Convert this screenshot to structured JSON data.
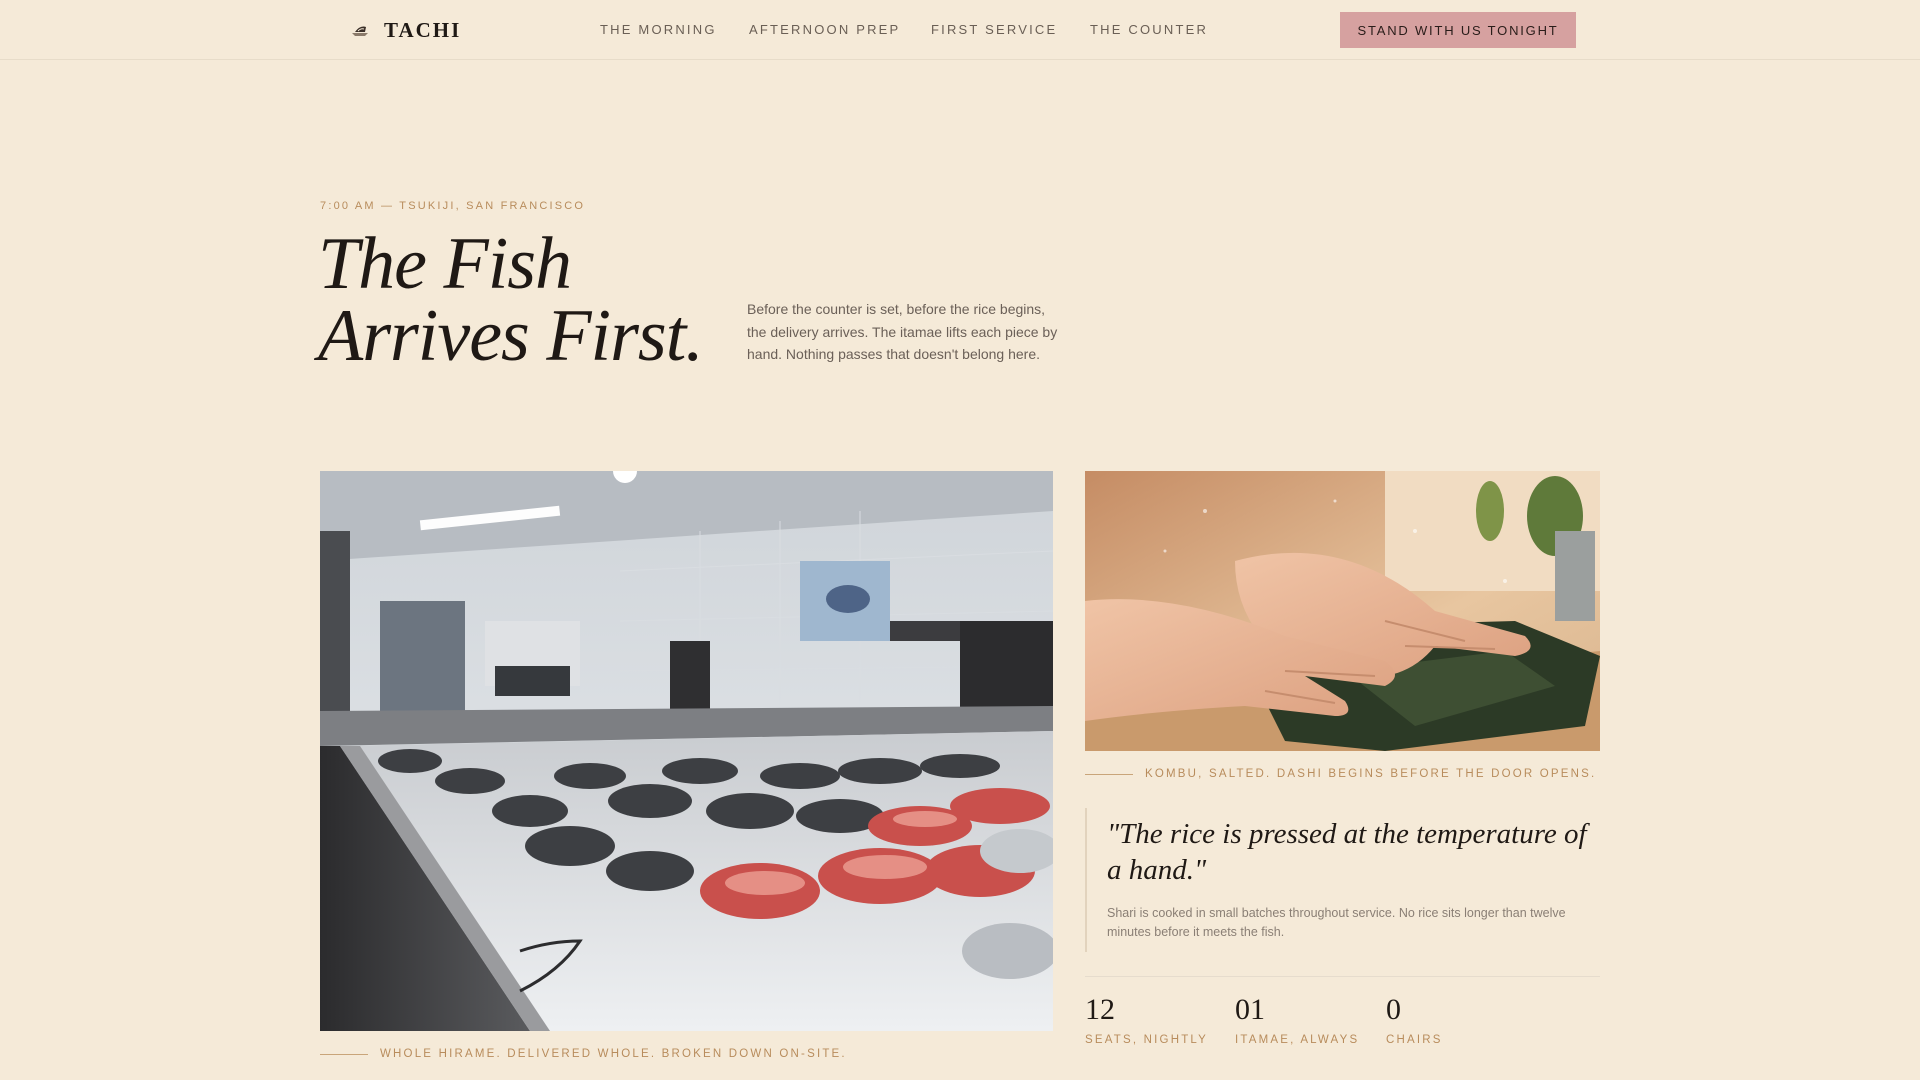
{
  "header": {
    "brand": "TACHI",
    "logo_icon": "sushi-boat-icon",
    "nav": [
      "THE MORNING",
      "AFTERNOON PREP",
      "FIRST SERVICE",
      "THE COUNTER"
    ],
    "cta": "STAND WITH US TONIGHT"
  },
  "hero": {
    "eyebrow": "7:00 AM — TSUKIJI, SAN FRANCISCO",
    "title_line_1": "The Fish",
    "title_line_2": "Arrives First.",
    "intro": "Before the counter is set, before the rice begins, the delivery arrives. The itamae lifts each piece by hand. Nothing passes that doesn't belong here."
  },
  "gallery": {
    "fish_caption": "WHOLE HIRAME. DELIVERED WHOLE. BROKEN DOWN ON-SITE.",
    "nori_caption": "KOMBU, SALTED. DASHI BEGINS BEFORE THE DOOR OPENS."
  },
  "quote": {
    "text": "\"The rice is pressed at the temperature of a hand.\"",
    "body": "Shari is cooked in small batches throughout service. No rice sits longer than twelve minutes before it meets the fish."
  },
  "stats": [
    {
      "value": "12",
      "label": "SEATS, NIGHTLY"
    },
    {
      "value": "01",
      "label": "ITAMAE, ALWAYS"
    },
    {
      "value": "0",
      "label": "CHAIRS"
    }
  ],
  "colors": {
    "background": "#f5ead8",
    "accent": "#d6a1a0",
    "label_gold": "#b88c5c",
    "ink": "#1f1915"
  }
}
